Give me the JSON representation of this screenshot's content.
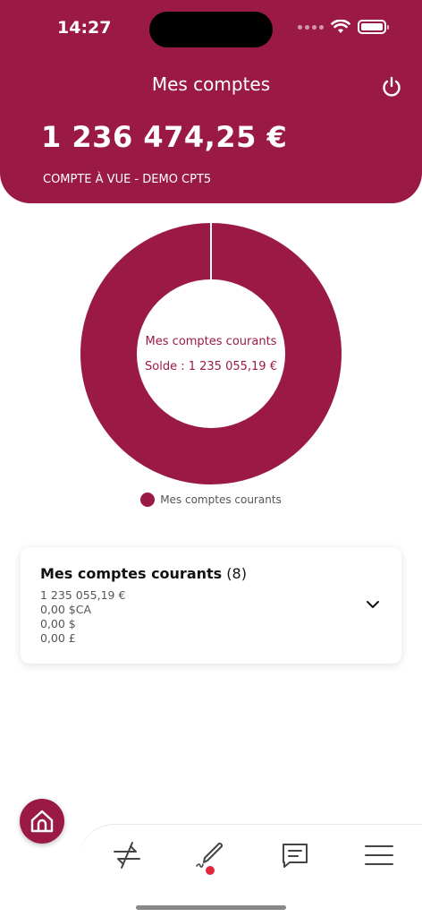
{
  "status_bar": {
    "time": "14:27"
  },
  "header": {
    "title": "Mes comptes",
    "total_balance": "1 236 474,25 €",
    "account_label": "COMPTE À VUE - DEMO CPT5",
    "accent_color": "#9b1a45"
  },
  "chart": {
    "center_title": "Mes comptes courants",
    "center_balance": "Solde : 1 235 055,19 €",
    "legend_label": "Mes comptes courants"
  },
  "chart_data": {
    "type": "pie",
    "variant": "donut",
    "slices": [
      {
        "label": "Mes comptes courants",
        "value": 1235055.19,
        "color": "#9b1a45"
      }
    ],
    "legend_position": "bottom"
  },
  "accounts_card": {
    "title": "Mes comptes courants",
    "count": "(8)",
    "balances": [
      "1 235 055,19 €",
      "0,00 $CA",
      "0,00 $",
      "0,00 £"
    ]
  },
  "tabbar": {
    "icons": [
      "home-icon",
      "transfer-icon",
      "signature-icon",
      "messages-icon",
      "menu-icon"
    ]
  }
}
